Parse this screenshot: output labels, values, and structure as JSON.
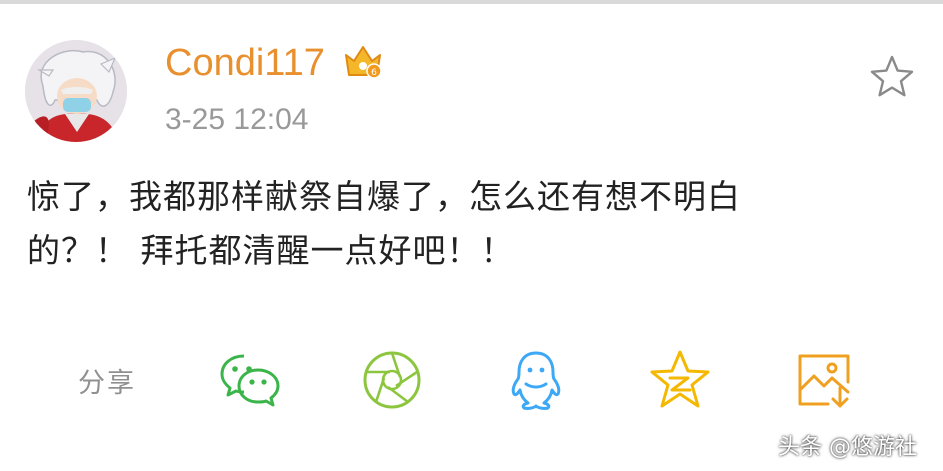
{
  "post": {
    "username": "Condi117",
    "timestamp": "3-25 12:04",
    "body_lines": [
      "惊了，我都那样献祭自爆了，怎么还有想不明白",
      "的？！ 拜托都清醒一点好吧！！"
    ]
  },
  "share": {
    "label": "分享",
    "targets": [
      {
        "icon": "wechat-icon",
        "color": "#3bb54a"
      },
      {
        "icon": "moments-icon",
        "color": "#8cc63f"
      },
      {
        "icon": "qq-icon",
        "color": "#3da8f5"
      },
      {
        "icon": "qzone-icon",
        "color": "#f5b800"
      },
      {
        "icon": "save-image-icon",
        "color": "#f0a020"
      }
    ]
  },
  "watermark": "头条 @悠游社",
  "colors": {
    "username": "#e8902e",
    "timestamp": "#999999",
    "body": "#222222",
    "share_label": "#909090"
  }
}
